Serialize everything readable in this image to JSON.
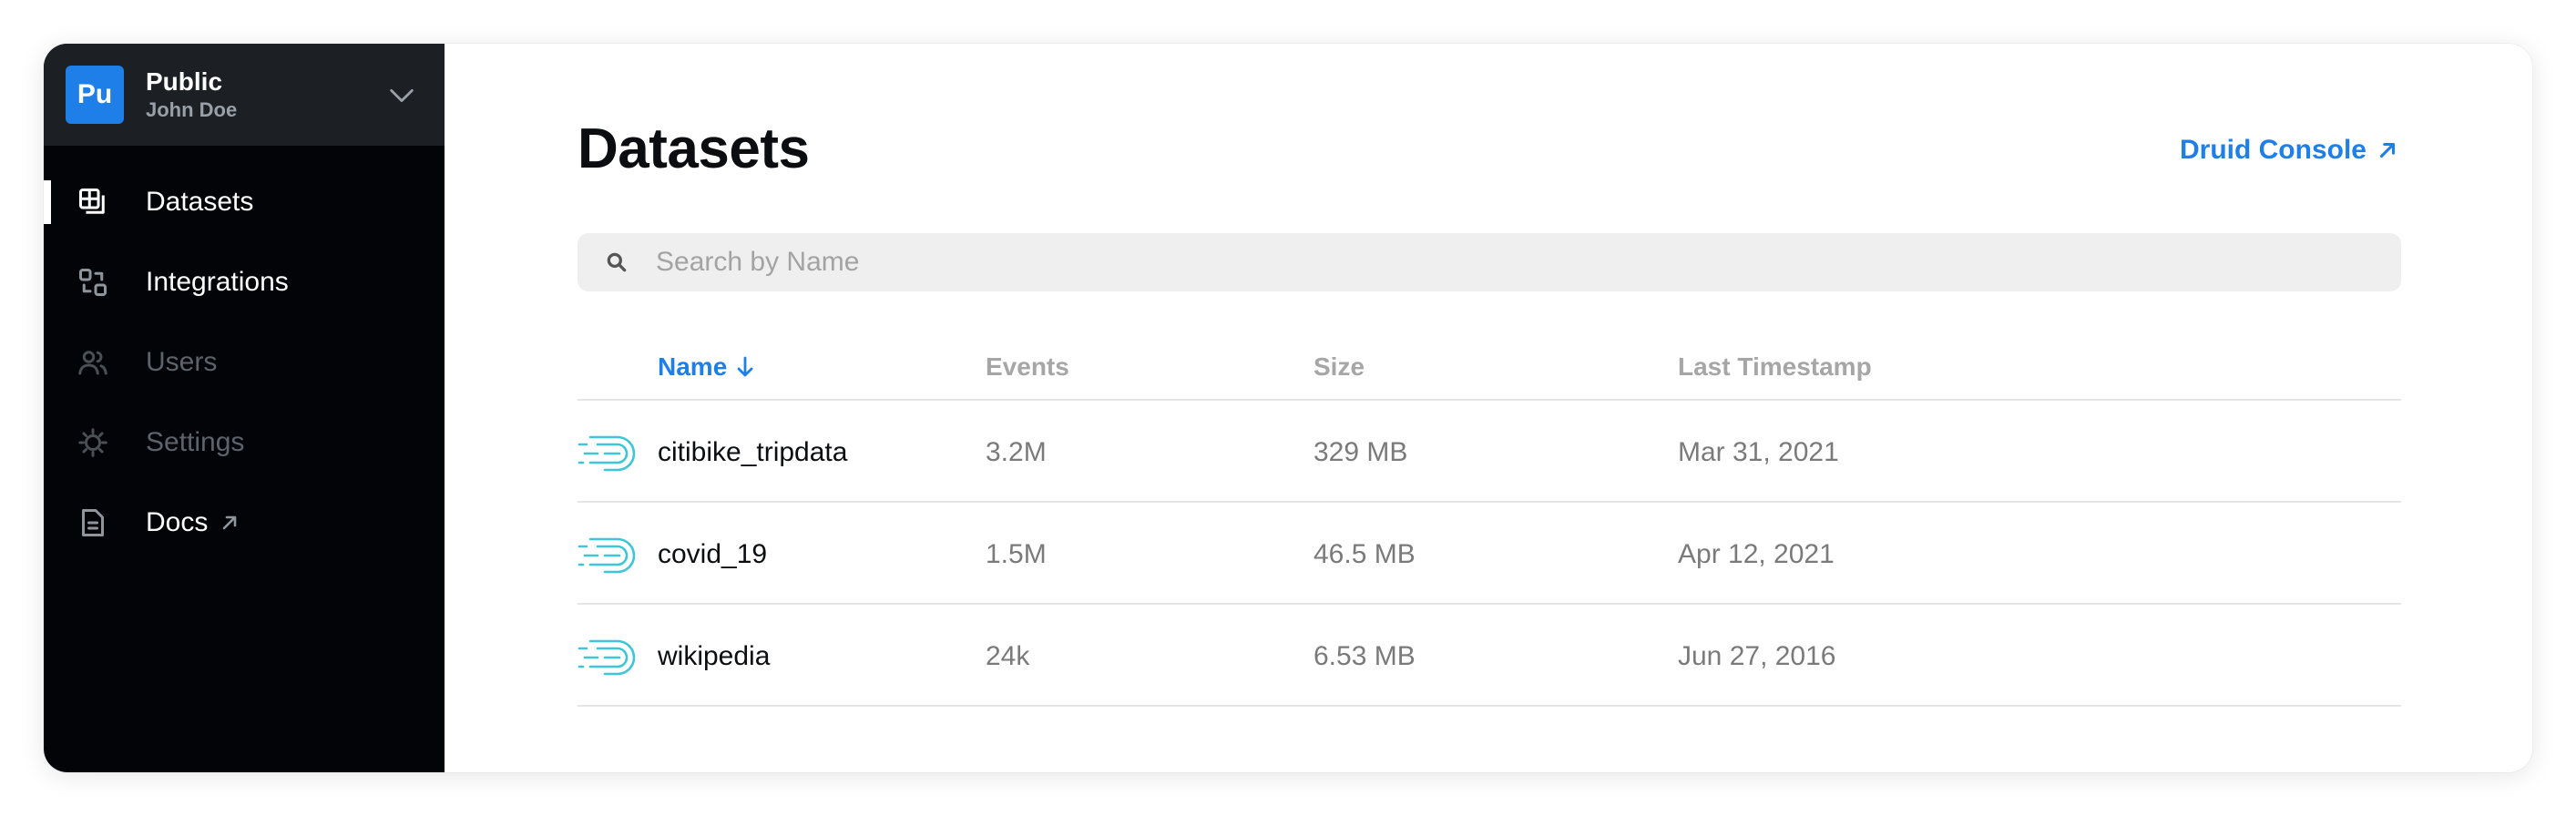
{
  "org": {
    "avatar": "Pu",
    "name": "Public",
    "user": "John Doe",
    "chevron_icon": "chevron-down-icon"
  },
  "sidebar": {
    "items": [
      {
        "label": "Datasets",
        "icon": "datasets-icon",
        "state": "active"
      },
      {
        "label": "Integrations",
        "icon": "integrations-icon",
        "state": "enabled"
      },
      {
        "label": "Users",
        "icon": "users-icon",
        "state": "disabled"
      },
      {
        "label": "Settings",
        "icon": "gear-icon",
        "state": "disabled"
      },
      {
        "label": "Docs",
        "icon": "document-icon",
        "state": "enabled",
        "external": true
      }
    ]
  },
  "main": {
    "title": "Datasets",
    "console_link": "Druid Console",
    "search": {
      "placeholder": "Search by Name",
      "value": ""
    },
    "table": {
      "columns": [
        {
          "label": "Name",
          "sorted": "desc"
        },
        {
          "label": "Events"
        },
        {
          "label": "Size"
        },
        {
          "label": "Last Timestamp"
        }
      ],
      "rows": [
        {
          "name": "citibike_tripdata",
          "events": "3.2M",
          "size": "329 MB",
          "last": "Mar 31, 2021"
        },
        {
          "name": "covid_19",
          "events": "1.5M",
          "size": "46.5 MB",
          "last": "Apr 12, 2021"
        },
        {
          "name": "wikipedia",
          "events": "24k",
          "size": "6.53 MB",
          "last": "Jun 27, 2016"
        }
      ]
    }
  },
  "colors": {
    "accent": "#1f7fe8",
    "sidebar_bg": "#020408",
    "org_bg": "#1c1f24",
    "dataset_icon": "#3ec6d8"
  }
}
